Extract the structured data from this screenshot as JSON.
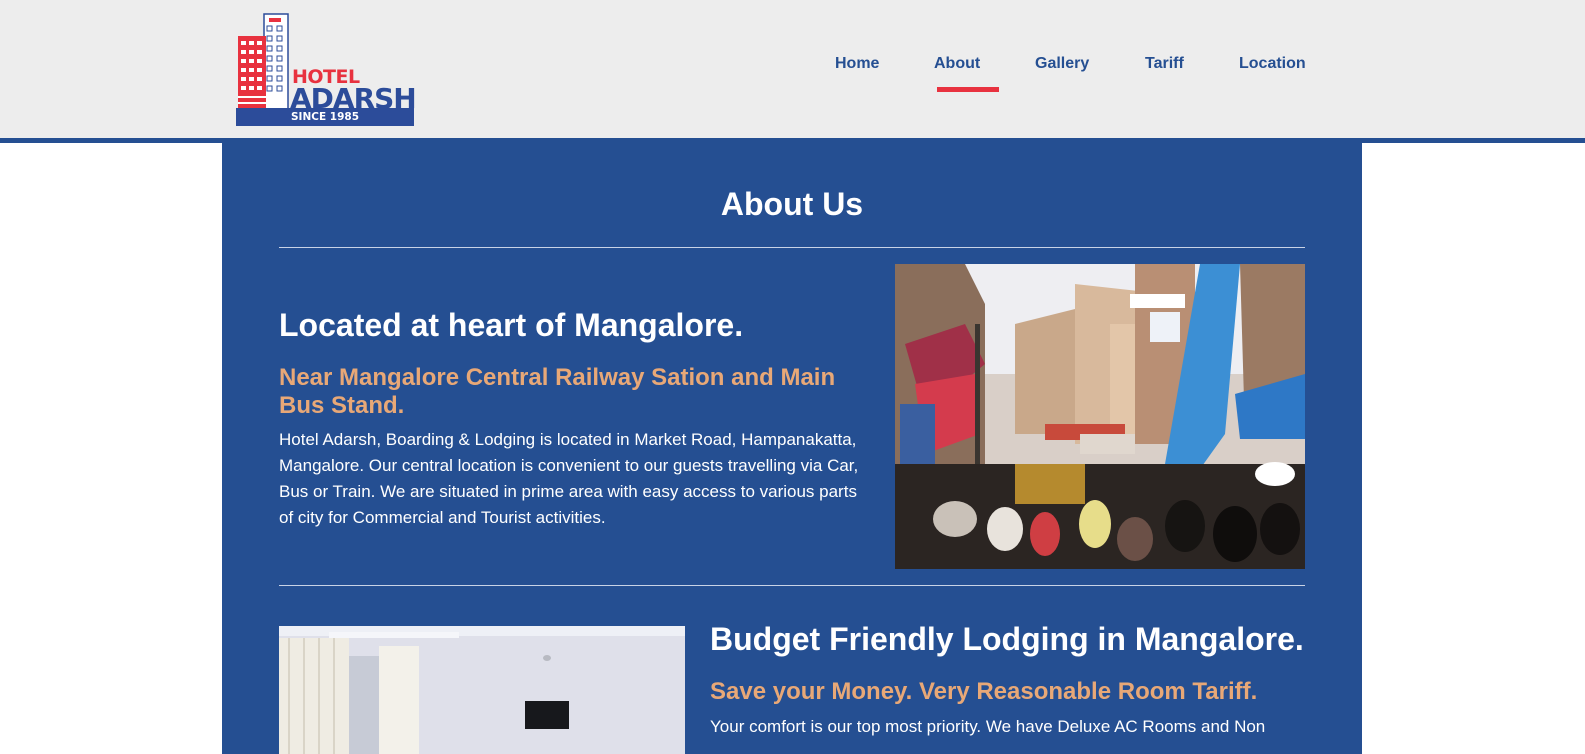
{
  "brand": {
    "hotel": "HOTEL",
    "name": "ADARSH",
    "since": "SINCE 1985"
  },
  "nav": {
    "items": [
      "Home",
      "About",
      "Gallery",
      "Tariff",
      "Location"
    ],
    "active": "About"
  },
  "page": {
    "title": "About Us"
  },
  "sections": [
    {
      "heading": "Located at heart of Mangalore.",
      "subheading": "Near Mangalore Central Railway Sation and Main Bus Stand.",
      "body": "Hotel Adarsh, Boarding & Lodging is located in Market Road, Hampanakatta, Mangalore. Our central location is convenient to our guests travelling via Car, Bus or Train. We are situated in prime area with easy access to various parts of city for Commercial and Tourist activities."
    },
    {
      "heading": "Budget Friendly Lodging in Mangalore.",
      "subheading": "Save your Money. Very Reasonable Room Tariff.",
      "body": "Your comfort is our top most priority. We have Deluxe AC Rooms and Non"
    }
  ],
  "colors": {
    "brand_blue": "#254f92",
    "accent_red": "#e8323f",
    "subheading_orange": "#e8a877",
    "header_bg": "#ededed"
  }
}
